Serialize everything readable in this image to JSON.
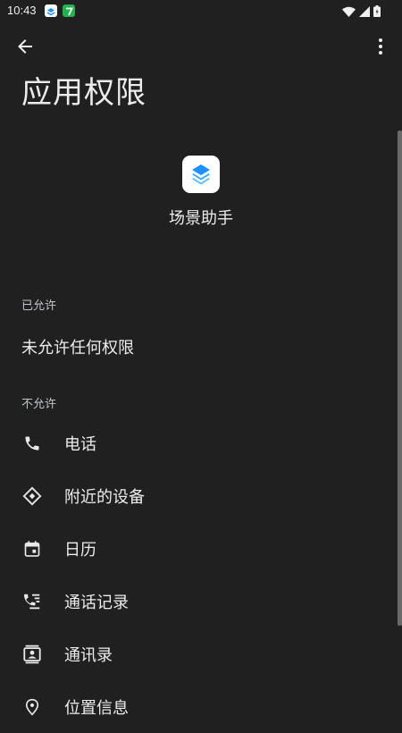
{
  "status_bar": {
    "time": "10:43",
    "icons": [
      "scene-assistant-notification-icon",
      "seven-app-notification-icon",
      "wifi-icon",
      "signal-icon",
      "battery-icon"
    ]
  },
  "header": {
    "back_icon": "arrow-back-icon",
    "more_icon": "more-vert-icon",
    "title": "应用权限"
  },
  "app": {
    "name": "场景助手",
    "icon": "stacked-layers-icon",
    "icon_color": "#1e90ff"
  },
  "allowed": {
    "header": "已允许",
    "none_text": "未允许任何权限"
  },
  "not_allowed": {
    "header": "不允许",
    "items": [
      {
        "label": "电话",
        "icon": "phone-icon"
      },
      {
        "label": "附近的设备",
        "icon": "nearby-devices-icon"
      },
      {
        "label": "日历",
        "icon": "calendar-icon"
      },
      {
        "label": "通话记录",
        "icon": "call-log-icon"
      },
      {
        "label": "通讯录",
        "icon": "contacts-icon"
      },
      {
        "label": "位置信息",
        "icon": "location-icon"
      }
    ]
  },
  "colors": {
    "background": "#202020",
    "text": "#ececec",
    "section_header": "#bfc4cc"
  }
}
